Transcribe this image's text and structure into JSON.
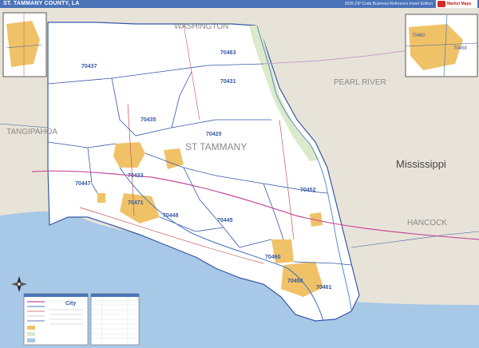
{
  "header": {
    "title": "ST. TAMMANY COUNTY, LA",
    "subtitle": "2026 ZIP Code Business Reference Insert Edition",
    "logo_text": "Market Maps"
  },
  "regions": {
    "washington": "WASHINGTON",
    "pearl_river": "PEARL RIVER",
    "tangipahoa": "TANGIPAHOA",
    "st_tammany": "ST TAMMANY",
    "mississippi": "Mississippi",
    "hancock": "HANCOCK"
  },
  "zip_labels": {
    "z70437": "70437",
    "z70463": "70463",
    "z70431": "70431",
    "z70435": "70435",
    "z70420": "70420",
    "z70433": "70433",
    "z70447": "70447",
    "z70471": "70471",
    "z70448": "70448",
    "z70445": "70445",
    "z70452": "70452",
    "z70460": "70460",
    "z70458": "70458",
    "z70461": "70461",
    "inset_70460": "70460",
    "inset_70458": "70458"
  },
  "legend": {
    "city_label": "City"
  },
  "colors": {
    "water": "#a7c8e6",
    "county_fill": "#ffffff",
    "neighbor_fill": "#e8e3d8",
    "urban": "#f0c267",
    "park": "#dbeacb",
    "zip_boundary": "#3558a8",
    "header": "#4a73b8"
  },
  "icons": {
    "compass": "compass-rose-icon",
    "logo": "market-maps-logo"
  }
}
